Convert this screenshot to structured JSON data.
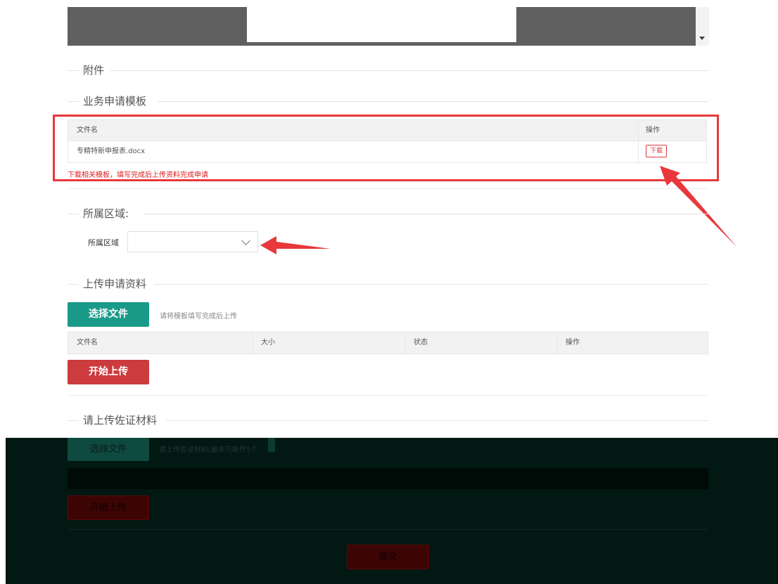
{
  "sections": {
    "attachments": "附件",
    "business_template": "业务申请模板",
    "region": "所属区域:",
    "upload_application": "上传申请资料",
    "upload_evidence": "请上传佐证材料"
  },
  "template_table": {
    "headers": [
      "文件名",
      "操作"
    ],
    "rows": [
      {
        "filename": "专精特新申报表.docx",
        "action": "下载"
      }
    ],
    "tip": "下载相关模板，填写完成后上传资料完成申请"
  },
  "region": {
    "label": "所属区域",
    "value": ""
  },
  "upload_application": {
    "choose_label": "选择文件",
    "hint": "请将模板填写完成后上传",
    "table_headers": [
      "文件名",
      "大小",
      "状态",
      "操作"
    ],
    "start_label": "开始上传"
  },
  "upload_evidence": {
    "choose_label": "选择文件",
    "hint": "请上传佐证材料(最多只能传5个",
    "start_label": "开始上传"
  },
  "submit_label": "提交",
  "colors": {
    "primary_green": "#1a9a88",
    "danger_red": "#cc3b3e",
    "highlight_red": "#e8383b"
  }
}
